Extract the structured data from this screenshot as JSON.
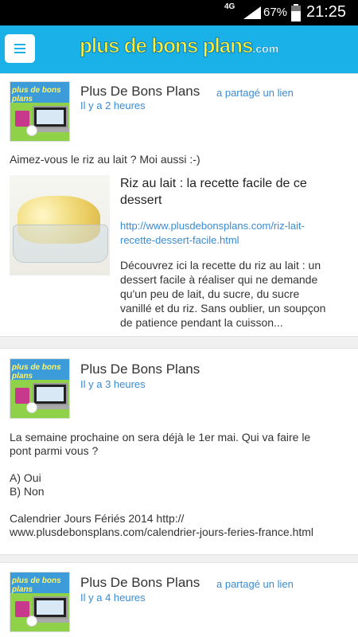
{
  "status_bar": {
    "network": "4G",
    "battery_percent": "67%",
    "time": "21:25",
    "icons": [
      "signal-icon",
      "battery-icon"
    ]
  },
  "header": {
    "logo_text": "plus de bons plans",
    "logo_domain": ".com",
    "menu_icon": "hamburger-menu-icon",
    "accent_color": "#1ab1e8"
  },
  "posts": [
    {
      "author": "Plus De Bons Plans",
      "action": "a partagé un lien",
      "time": "Il y a 2 heures",
      "text": "Aimez-vous le riz au lait ? Moi aussi :-)",
      "link": {
        "title_lines": [
          "Riz au lait : la recette facile de ce",
          "dessert"
        ],
        "url_lines": [
          "http://www.plusdebonsplans.com/riz-lait-",
          "recette-dessert-facile.html"
        ],
        "description_lines": [
          "Découvrez ici la recette du riz au lait : un",
          "dessert facile à réaliser qui ne demande",
          "qu'un peu de lait, du sucre, du sucre",
          "vanillé et du riz. Sans oublier, un soupçon",
          "de patience pendant la cuisson..."
        ]
      }
    },
    {
      "author": "Plus De Bons Plans",
      "time": "Il y a 3 heures",
      "text_lines": [
        "La semaine prochaine on sera déjà le 1er mai. Qui va faire le",
        "pont parmi vous ?",
        "",
        "A) Oui",
        "B) Non",
        "",
        "Calendrier Jours Fériés 2014 http://",
        "www.plusdebonsplans.com/calendrier-jours-feries-france.html"
      ]
    },
    {
      "author": "Plus De Bons Plans",
      "action": "a partagé un lien",
      "time": "Il y a 4 heures"
    }
  ],
  "colors": {
    "link_blue": "#3a8bd2",
    "text_dark": "#333333",
    "background": "#f0f0f0"
  }
}
